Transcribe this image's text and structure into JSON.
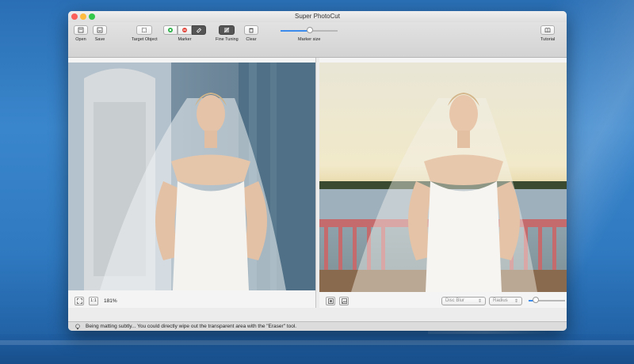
{
  "window": {
    "title": "Super PhotoCut"
  },
  "toolbar": {
    "open_label": "Open",
    "save_label": "Save",
    "target_object_label": "Target Object",
    "marker_label": "Marker",
    "fine_tuning_label": "Fine Tuning",
    "clear_label": "Clear",
    "marker_size_label": "Marker size",
    "marker_size_value": 0.52,
    "tutorial_label": "Tutorial"
  },
  "left_panel": {
    "fit_button_label": "",
    "actual_size_label": "1:1",
    "zoom_level": "181%"
  },
  "right_panel": {
    "blur_select": {
      "selected": "Disc Blur"
    },
    "radius_select": {
      "selected": "Radius"
    },
    "radius_value": 0.2
  },
  "status": {
    "hint": "Being matting subtly... You could directly wipe out the transparent area with the \"Eraser\" tool."
  },
  "colors": {
    "accent": "#3b8bed",
    "light_close": "#fc605b",
    "light_min": "#fdbc40",
    "light_max": "#34c84a"
  }
}
